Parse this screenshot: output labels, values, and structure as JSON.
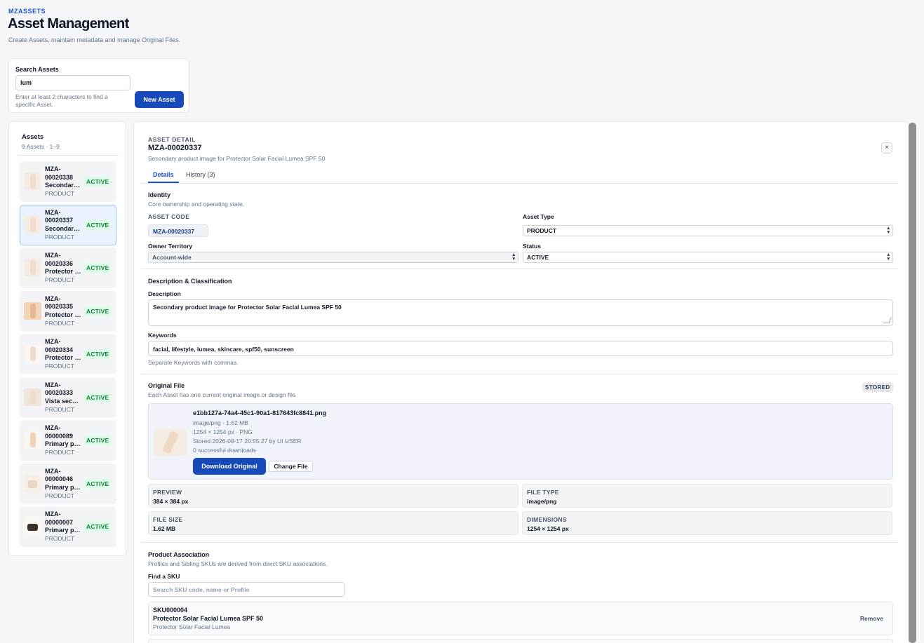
{
  "header": {
    "brand": "MZASSETS",
    "title": "Asset Management",
    "subtitle": "Create Assets, maintain metadata and manage Original Files."
  },
  "search": {
    "label": "Search Assets",
    "value": "lum",
    "hint": "Enter at least 2 characters to find a specific Asset.",
    "new_button": "New Asset"
  },
  "asset_list": {
    "title": "Assets",
    "count": "9 Assets · 1–9",
    "items": [
      {
        "code": "MZA-00020338",
        "desc": "Secondary product image",
        "type": "PRODUCT",
        "status": "ACTIVE"
      },
      {
        "code": "MZA-00020337",
        "desc": "Secondary product image",
        "type": "PRODUCT",
        "status": "ACTIVE"
      },
      {
        "code": "MZA-00020336",
        "desc": "Protector Solar",
        "type": "PRODUCT",
        "status": "ACTIVE"
      },
      {
        "code": "MZA-00020335",
        "desc": "Protector Solar",
        "type": "PRODUCT",
        "status": "ACTIVE"
      },
      {
        "code": "MZA-00020334",
        "desc": "Protector Solar",
        "type": "PRODUCT",
        "status": "ACTIVE"
      },
      {
        "code": "MZA-00020333",
        "desc": "Vista secundaria",
        "type": "PRODUCT",
        "status": "ACTIVE"
      },
      {
        "code": "MZA-00000089",
        "desc": "Primary product image",
        "type": "PRODUCT",
        "status": "ACTIVE"
      },
      {
        "code": "MZA-00000046",
        "desc": "Primary product image",
        "type": "PRODUCT",
        "status": "ACTIVE"
      },
      {
        "code": "MZA-00000007",
        "desc": "Primary product image",
        "type": "PRODUCT",
        "status": "ACTIVE"
      }
    ]
  },
  "detail": {
    "eyebrow": "ASSET DETAIL",
    "code": "MZA-00020337",
    "subtitle": "Secondary product image for Protector Solar Facial Lumea SPF 50",
    "close": "×",
    "tabs": [
      {
        "label": "Details"
      },
      {
        "label": "History (3)"
      }
    ],
    "identity": {
      "title": "Identity",
      "subtitle": "Core ownership and operating state.",
      "asset_code_label": "ASSET CODE",
      "asset_code": "MZA-00020337",
      "asset_type_label": "Asset Type",
      "asset_type": "PRODUCT",
      "owner_label": "Owner Territory",
      "owner": "Account-wide",
      "status_label": "Status",
      "status": "ACTIVE"
    },
    "classification": {
      "title": "Description & Classification",
      "description_label": "Description",
      "description": "Secondary product image for Protector Solar Facial Lumea SPF 50",
      "keywords_label": "Keywords",
      "keywords": "facial, lifestyle, lumea, skincare, spf50, sunscreen",
      "keywords_hint": "Separate Keywords with commas."
    },
    "original_file": {
      "title": "Original File",
      "subtitle": "Each Asset has one current original image or design file.",
      "badge": "STORED",
      "filename": "e1bb127a-74a4-45c1-90a1-817643fc8841.png",
      "mime_size": "image/png · 1.62 MB",
      "dims_format": "1254 × 1254 px · PNG",
      "stored": "Stored 2026-08-17 20:55:27 by UI USER",
      "downloads": "0 successful downloads",
      "download_button": "Download Original",
      "change_button": "Change File"
    },
    "stats": [
      {
        "key": "PREVIEW",
        "value": "384 × 384 px"
      },
      {
        "key": "FILE TYPE",
        "value": "image/png"
      },
      {
        "key": "FILE SIZE",
        "value": "1.62 MB"
      },
      {
        "key": "DIMENSIONS",
        "value": "1254 × 1254 px"
      }
    ],
    "product": {
      "title": "Product Association",
      "subtitle": "Profiles and Sibling SKUs are derived from direct SKU associations.",
      "find_label": "Find a SKU",
      "find_placeholder": "Search SKU code, name or Profile",
      "sku": {
        "code": "SKU000004",
        "name": "Protector Solar Facial Lumea SPF 50",
        "profile": "Protector Solar Facial Lumea",
        "remove": "Remove"
      }
    }
  }
}
